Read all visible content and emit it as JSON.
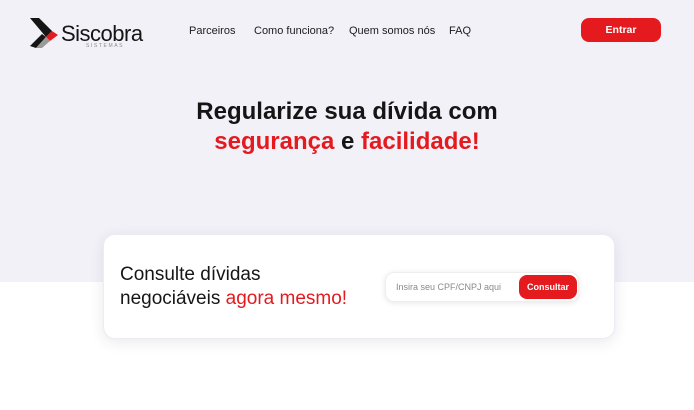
{
  "brand": {
    "name": "Siscobra",
    "subtitle": "SISTEMAS",
    "colors": {
      "accent": "#e41a1f",
      "dark": "#151515",
      "hero_bg": "#f2f1f8"
    }
  },
  "nav": {
    "items": [
      {
        "label": "Parceiros"
      },
      {
        "label": "Como funciona?"
      },
      {
        "label": "Quem somos nós"
      },
      {
        "label": "FAQ"
      }
    ],
    "enter_label": "Entrar"
  },
  "hero": {
    "line1": "Regularize sua dívida com",
    "word_security": "segurança",
    "connector": " e ",
    "word_ease": "facilidade!"
  },
  "consult": {
    "title_line1": "Consulte dívidas",
    "title_line2_prefix": "negociáveis ",
    "title_line2_accent": "agora mesmo!",
    "input_placeholder": "Insira seu CPF/CNPJ aqui",
    "input_value": "",
    "button_label": "Consultar"
  }
}
